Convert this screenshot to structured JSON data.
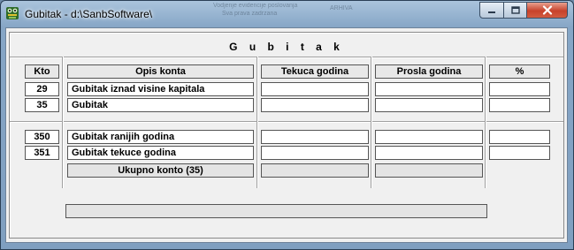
{
  "window": {
    "title": "Gubitak - d:\\SanbSoftware\\",
    "icon": "frog-app-icon",
    "background_text": [
      "Vodjenje evidencije poslovanja",
      "ARHIVA",
      "Sva prava zadrzana"
    ]
  },
  "form": {
    "heading": "G u b i t a k",
    "columns": {
      "kto": "Kto",
      "opis": "Opis konta",
      "tekuca": "Tekuca godina",
      "prosla": "Prosla godina",
      "pct": "%"
    },
    "rows": [
      {
        "kto": "29",
        "opis": "Gubitak iznad visine kapitala",
        "tekuca": "",
        "prosla": "",
        "pct": ""
      },
      {
        "kto": "35",
        "opis": "Gubitak",
        "tekuca": "",
        "prosla": "",
        "pct": ""
      },
      {
        "kto": "350",
        "opis": "Gubitak ranijih godina",
        "tekuca": "",
        "prosla": "",
        "pct": ""
      },
      {
        "kto": "351",
        "opis": "Gubitak tekuce godina",
        "tekuca": "",
        "prosla": "",
        "pct": ""
      }
    ],
    "total_label": "Ukupno konto (35)",
    "total_tekuca": "",
    "total_prosla": "",
    "status": ""
  },
  "colors": {
    "close_button": "#c7422b",
    "client_bg": "#f0f0f0"
  }
}
